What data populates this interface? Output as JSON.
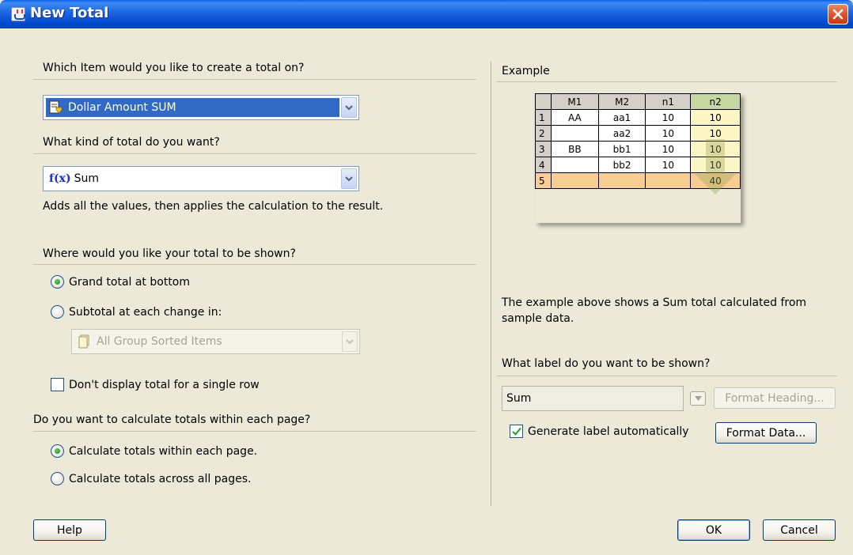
{
  "window": {
    "title": "New Total"
  },
  "left": {
    "item_question": "Which Item would you like to create a total on?",
    "item_value": "Dollar Amount SUM",
    "kind_question": "What kind of total do you want?",
    "kind_icon_text": "f(x)",
    "kind_value": "Sum",
    "kind_description": "Adds all the values, then applies the calculation to the result.",
    "where_question": "Where would you like your total to be shown?",
    "grand_total_label": "Grand total at bottom",
    "subtotal_label": "Subtotal at each change in:",
    "group_value": "All Group Sorted Items",
    "single_row_label": "Don't display total for a single row",
    "page_question": "Do you want to calculate totals within each page?",
    "within_page_label": "Calculate totals within each page.",
    "across_pages_label": "Calculate totals across all pages."
  },
  "right": {
    "example_heading": "Example",
    "example_table": {
      "headers": [
        "M1",
        "M2",
        "n1",
        "n2"
      ],
      "rows": [
        {
          "num": "1",
          "m1": "AA",
          "m2": "aa1",
          "n1": "10",
          "n2": "10"
        },
        {
          "num": "2",
          "m1": "",
          "m2": "aa2",
          "n1": "10",
          "n2": "10"
        },
        {
          "num": "3",
          "m1": "BB",
          "m2": "bb1",
          "n1": "10",
          "n2": "10"
        },
        {
          "num": "4",
          "m1": "",
          "m2": "bb2",
          "n1": "10",
          "n2": "10"
        },
        {
          "num": "5",
          "m1": "",
          "m2": "",
          "n1": "",
          "n2": "40"
        }
      ]
    },
    "example_caption": "The example above shows a Sum total calculated from sample data.",
    "label_question": "What label do you want to be shown?",
    "label_value": "Sum",
    "format_heading_label": "Format Heading...",
    "generate_label": "Generate label automatically",
    "format_data_label": "Format Data..."
  },
  "footer": {
    "help_label": "Help",
    "ok_label": "OK",
    "cancel_label": "Cancel"
  },
  "state": {
    "grand_total_selected": true,
    "subtotal_selected": false,
    "single_row_checked": false,
    "within_page_selected": true,
    "across_pages_selected": false,
    "generate_label_checked": true
  },
  "colors": {
    "titlebar": "#0A5FE8",
    "dialog_bg": "#ECE9D8",
    "selection": "#316AC5",
    "highlight_column": "#FDF7C5",
    "total_row": "#F9CE92"
  }
}
